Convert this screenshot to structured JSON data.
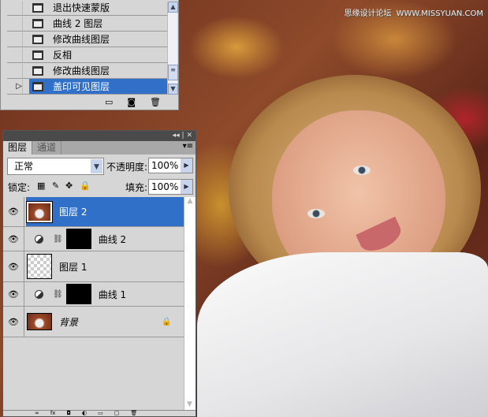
{
  "watermark": {
    "cn": "思缘设计论坛",
    "url": "WWW.MISSYUAN.COM"
  },
  "history": {
    "items": [
      {
        "label": "退出快速蒙版",
        "selected": false
      },
      {
        "label": "曲线 2 图层",
        "selected": false
      },
      {
        "label": "修改曲线图层",
        "selected": false
      },
      {
        "label": "反相",
        "selected": false
      },
      {
        "label": "修改曲线图层",
        "selected": false
      },
      {
        "label": "盖印可见图层",
        "selected": true
      }
    ]
  },
  "layers_panel": {
    "tabs": [
      "图层",
      "通道"
    ],
    "blend_mode": "正常",
    "opacity_label": "不透明度:",
    "opacity": "100%",
    "lock_label": "锁定:",
    "fill_label": "填充:",
    "fill": "100%",
    "layers": [
      {
        "name": "图层 2",
        "type": "pixel",
        "selected": true
      },
      {
        "name": "曲线 2",
        "type": "curves"
      },
      {
        "name": "图层 1",
        "type": "transparent"
      },
      {
        "name": "曲线 1",
        "type": "curves"
      },
      {
        "name": "背景",
        "type": "background",
        "locked": true
      }
    ]
  }
}
